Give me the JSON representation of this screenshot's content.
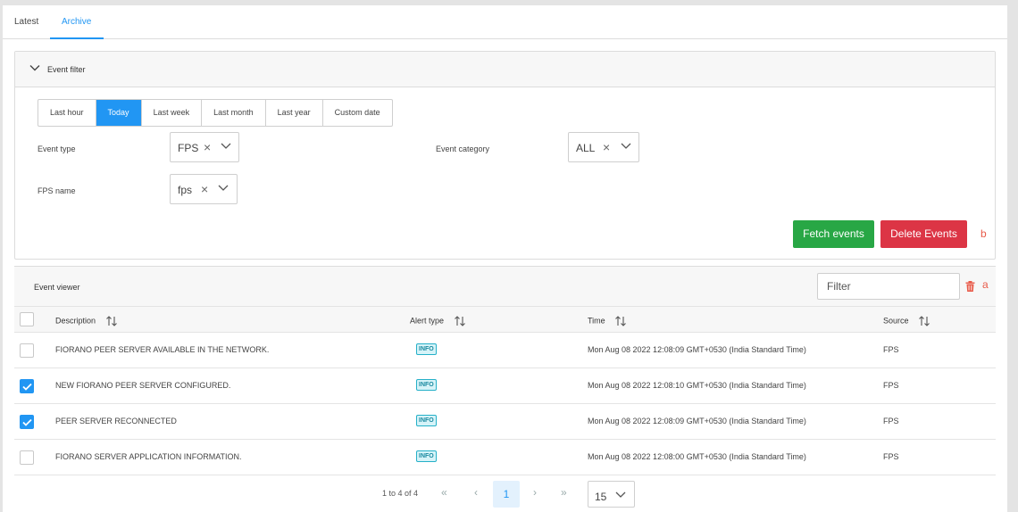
{
  "tabs": [
    {
      "label": "Latest",
      "active": false
    },
    {
      "label": "Archive",
      "active": true
    }
  ],
  "event_filter": {
    "title": "Event filter",
    "collapse_icon": "chevron-down-icon",
    "ranges": [
      "Last hour",
      "Today",
      "Last week",
      "Last month",
      "Last year",
      "Custom date"
    ],
    "active_range": "Today",
    "event_type": {
      "label": "Event type",
      "value": "FPS"
    },
    "event_category": {
      "label": "Event category",
      "value": "ALL"
    },
    "fps_name": {
      "label": "FPS name",
      "value": "fps"
    },
    "clear_glyph": "×",
    "fetch_label": "Fetch events",
    "delete_label": "Delete Events",
    "marker_b": "b",
    "colors": {
      "accent": "#2196f3",
      "fetch": "#28a745",
      "delete": "#dc3545"
    }
  },
  "event_viewer": {
    "title": "Event viewer",
    "filter_placeholder": "Filter",
    "delete_icon": "trash-icon",
    "marker_a": "a",
    "columns": [
      "Description",
      "Alert type",
      "Time",
      "Source"
    ],
    "rows": [
      {
        "checked": false,
        "description": "FIORANO PEER SERVER AVAILABLE IN THE NETWORK.",
        "alert_type": "INFO",
        "time": "Mon Aug 08 2022 12:08:09 GMT+0530 (India Standard Time)",
        "source": "FPS"
      },
      {
        "checked": true,
        "description": "NEW FIORANO PEER SERVER CONFIGURED.",
        "alert_type": "INFO",
        "time": "Mon Aug 08 2022 12:08:10 GMT+0530 (India Standard Time)",
        "source": "FPS"
      },
      {
        "checked": true,
        "description": "PEER SERVER RECONNECTED",
        "alert_type": "INFO",
        "time": "Mon Aug 08 2022 12:08:09 GMT+0530 (India Standard Time)",
        "source": "FPS"
      },
      {
        "checked": false,
        "description": "FIORANO SERVER APPLICATION INFORMATION.",
        "alert_type": "INFO",
        "time": "Mon Aug 08 2022 12:08:00 GMT+0530 (India Standard Time)",
        "source": "FPS"
      }
    ]
  },
  "pagination": {
    "info": "1 to 4 of 4",
    "first": "«",
    "prev": "‹",
    "current_page": "1",
    "next": "›",
    "last": "»",
    "page_size": "15"
  }
}
